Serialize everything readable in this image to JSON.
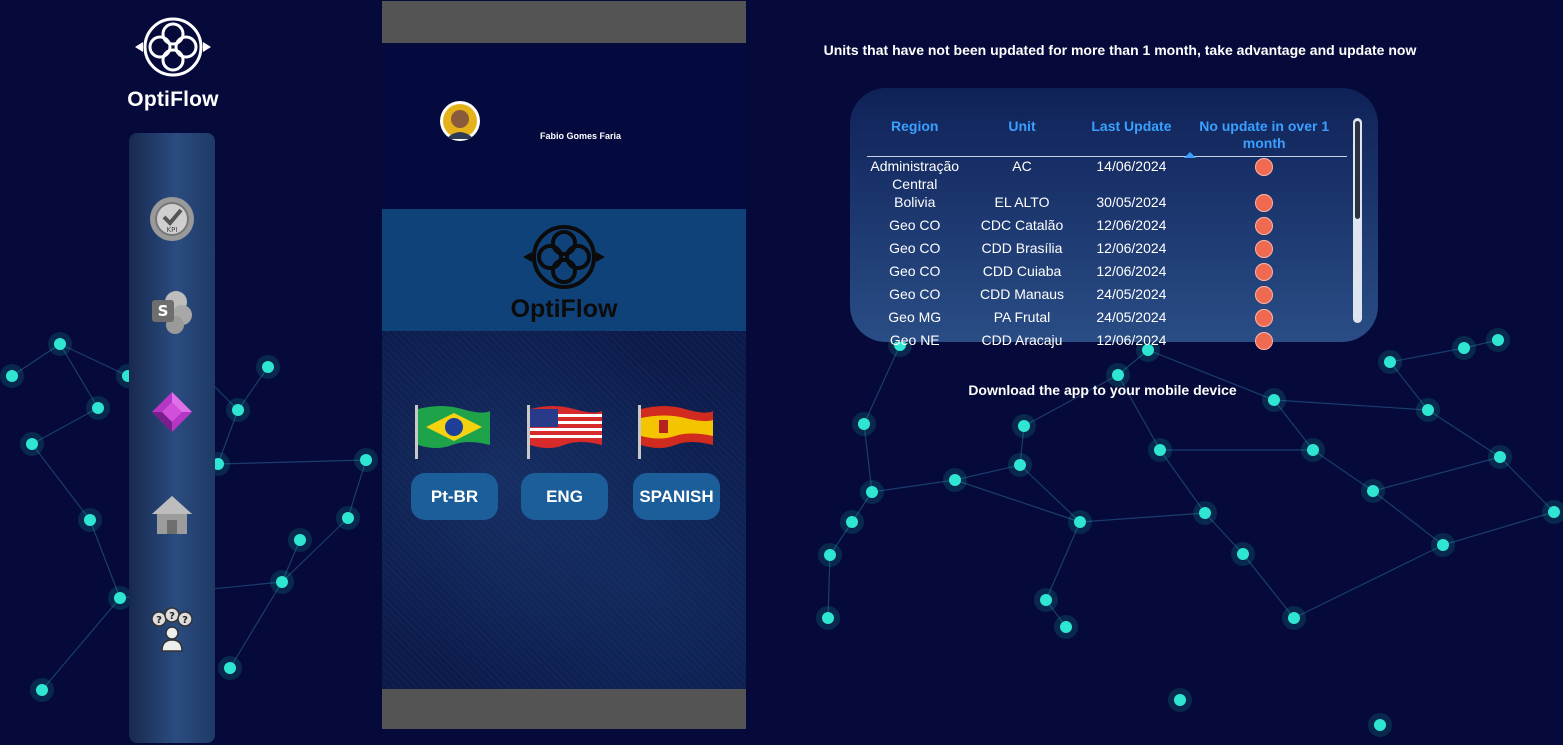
{
  "brand": {
    "name": "OptiFlow",
    "accent": "#ffffff"
  },
  "sidebar": {
    "items": [
      {
        "icon": "kpi-icon",
        "label": "KPI"
      },
      {
        "icon": "sharepoint-icon",
        "label": "S"
      },
      {
        "icon": "power-apps-icon"
      },
      {
        "icon": "home-icon"
      },
      {
        "icon": "help-people-icon",
        "label": "???"
      }
    ]
  },
  "phone": {
    "user_name": "Fabio Gomes Faria",
    "banner_name": "OptiFlow",
    "languages": [
      {
        "flag": "brazil-flag",
        "label": "Pt-BR"
      },
      {
        "flag": "usa-flag",
        "label": "ENG"
      },
      {
        "flag": "spain-flag",
        "label": "SPANISH"
      }
    ]
  },
  "notice": "Units that have not been updated for more than 1 month, take advantage and update now",
  "table": {
    "columns": [
      "Region",
      "Unit",
      "Last Update",
      "No update in over 1 month"
    ],
    "rows": [
      {
        "region": "Administração Central",
        "unit": "AC",
        "last_update": "14/06/2024",
        "status": "red"
      },
      {
        "region": "Bolivia",
        "unit": "EL ALTO",
        "last_update": "30/05/2024",
        "status": "red"
      },
      {
        "region": "Geo CO",
        "unit": "CDC Catalão",
        "last_update": "12/06/2024",
        "status": "red"
      },
      {
        "region": "Geo CO",
        "unit": "CDD Brasília",
        "last_update": "12/06/2024",
        "status": "red"
      },
      {
        "region": "Geo CO",
        "unit": "CDD Cuiaba",
        "last_update": "12/06/2024",
        "status": "red"
      },
      {
        "region": "Geo CO",
        "unit": "CDD Manaus",
        "last_update": "24/05/2024",
        "status": "red"
      },
      {
        "region": "Geo MG",
        "unit": "PA Frutal",
        "last_update": "24/05/2024",
        "status": "red"
      },
      {
        "region": "Geo NE",
        "unit": "CDD Aracaju",
        "last_update": "12/06/2024",
        "status": "red"
      }
    ],
    "status_color": "#f06a52",
    "header_color": "#3aa0ff"
  },
  "download_text": "Download the app to your mobile device"
}
